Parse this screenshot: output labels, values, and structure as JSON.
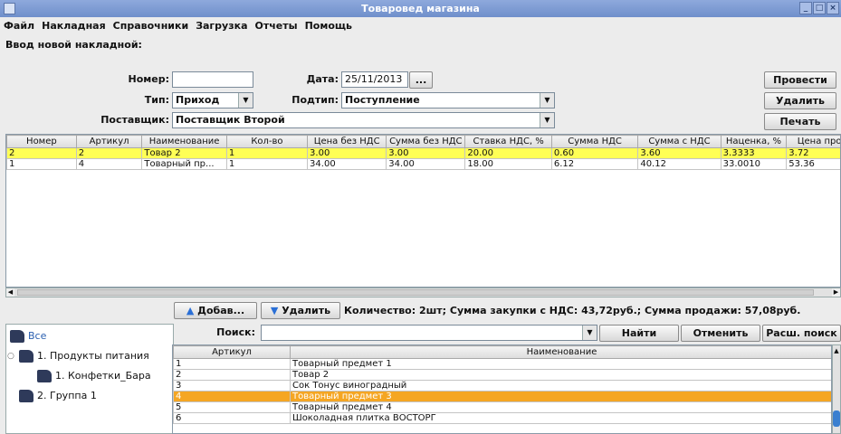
{
  "window": {
    "title": "Товаровед магазина"
  },
  "menu": [
    "Файл",
    "Накладная",
    "Справочники",
    "Загрузка",
    "Отчеты",
    "Помощь"
  ],
  "form": {
    "caption": "Ввод новой накладной:",
    "number_label": "Номер:",
    "number_value": "",
    "date_label": "Дата:",
    "date_value": "25/11/2013",
    "date_button": "...",
    "type_label": "Тип:",
    "type_value": "Приход",
    "subtype_label": "Подтип:",
    "subtype_value": "Поступление",
    "supplier_label": "Поставщик:",
    "supplier_value": "Поставщик Второй"
  },
  "actions": {
    "post": "Провести",
    "delete": "Удалить",
    "print": "Печать"
  },
  "invoice_table": {
    "columns": [
      "Номер",
      "Артикул",
      "Наименование",
      "Кол-во",
      "Цена без НДС",
      "Сумма без НДС",
      "Ставка НДС, %",
      "Сумма НДС",
      "Сумма с НДС",
      "Наценка, %",
      "Цена про"
    ],
    "rows": [
      [
        "2",
        "2",
        "Товар 2",
        "1",
        "3.00",
        "3.00",
        "20.00",
        "0.60",
        "3.60",
        "3.3333",
        "3.72"
      ],
      [
        "1",
        "4",
        "Товарный пр...",
        "1",
        "34.00",
        "34.00",
        "18.00",
        "6.12",
        "40.12",
        "33.0010",
        "53.36"
      ]
    ],
    "selected_row": 0
  },
  "row_actions": {
    "add": "Добав...",
    "remove": "Удалить"
  },
  "summary": "Количество: 2шт; Сумма закупки с НДС: 43,72руб.; Сумма продажи: 57,08руб.",
  "tree": {
    "root": "Все",
    "items": [
      {
        "label": "1. Продукты питания",
        "level": 1
      },
      {
        "label": "1. Конфетки_Бара",
        "level": 2
      },
      {
        "label": "2. Группа 1",
        "level": 1
      }
    ]
  },
  "search": {
    "label": "Поиск:",
    "value": "",
    "find": "Найти",
    "cancel": "Отменить",
    "advanced": "Расш. поиск"
  },
  "product_table": {
    "columns": [
      "Артикул",
      "Наименование"
    ],
    "rows": [
      [
        "1",
        "Товарный предмет 1"
      ],
      [
        "2",
        "Товар 2"
      ],
      [
        "3",
        "Сок Тонус виноградный"
      ],
      [
        "4",
        "Товарный предмет 3"
      ],
      [
        "5",
        "Товарный предмет 4"
      ],
      [
        "6",
        "Шоколадная плитка ВОСТОРГ"
      ]
    ],
    "selected_row": 3
  },
  "colors": {
    "titlebar": "#7b98d3",
    "selected_invoice_row": "#ffff55",
    "selected_product_row": "#f5a623"
  }
}
